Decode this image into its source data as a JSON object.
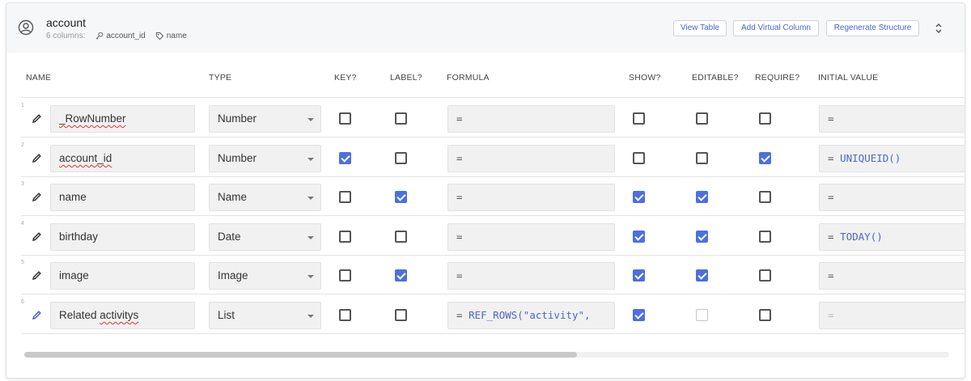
{
  "table": {
    "title": "account",
    "column_count": "6 columns:",
    "key_field": "account_id",
    "label_field": "name"
  },
  "actions": {
    "view_table": "View Table",
    "add_virtual_column": "Add Virtual Column",
    "regenerate_structure": "Regenerate Structure"
  },
  "columns": {
    "name": "NAME",
    "type": "TYPE",
    "key": "KEY?",
    "label": "LABEL?",
    "formula": "FORMULA",
    "show": "SHOW?",
    "editable": "EDITABLE?",
    "require": "REQUIRE?",
    "initial_value": "INITIAL VALUE"
  },
  "rows": [
    {
      "num": "1",
      "name": "_RowNumber",
      "type": "Number",
      "key": false,
      "label": false,
      "formula_eq": "=",
      "formula_fn": "",
      "show": false,
      "editable": false,
      "require": false,
      "init_eq": "=",
      "init_fn": ""
    },
    {
      "num": "2",
      "name": "account_id",
      "type": "Number",
      "key": true,
      "label": false,
      "formula_eq": "=",
      "formula_fn": "",
      "show": false,
      "editable": false,
      "require": true,
      "init_eq": "=",
      "init_fn": "UNIQUEID()"
    },
    {
      "num": "3",
      "name": "name",
      "type": "Name",
      "key": false,
      "label": true,
      "formula_eq": "=",
      "formula_fn": "",
      "show": true,
      "editable": true,
      "require": false,
      "init_eq": "=",
      "init_fn": ""
    },
    {
      "num": "4",
      "name": "birthday",
      "type": "Date",
      "key": false,
      "label": false,
      "formula_eq": "=",
      "formula_fn": "",
      "show": true,
      "editable": true,
      "require": false,
      "init_eq": "=",
      "init_fn": "TODAY()"
    },
    {
      "num": "5",
      "name": "image",
      "type": "Image",
      "key": false,
      "label": true,
      "formula_eq": "=",
      "formula_fn": "",
      "show": true,
      "editable": true,
      "require": false,
      "init_eq": "=",
      "init_fn": ""
    },
    {
      "num": "6",
      "name_a": "Related ",
      "name_b": "activitys",
      "type": "List",
      "key": false,
      "label": false,
      "formula_eq": "=",
      "formula_fn": "REF_ROWS(\"activity\",",
      "show": true,
      "editable": false,
      "require": false,
      "init_eq": "=",
      "init_fn": ""
    }
  ],
  "colors": {
    "accent": "#4d6fe0",
    "link": "#4a67c9",
    "header_bg": "#f6f7f8"
  },
  "scrollbar": {
    "horizontal_position": 0
  },
  "icons": {
    "table": "account-circle-icon",
    "key": "key-icon",
    "label": "tag-icon",
    "edit": "pencil-icon",
    "expand": "unfold-icon"
  }
}
